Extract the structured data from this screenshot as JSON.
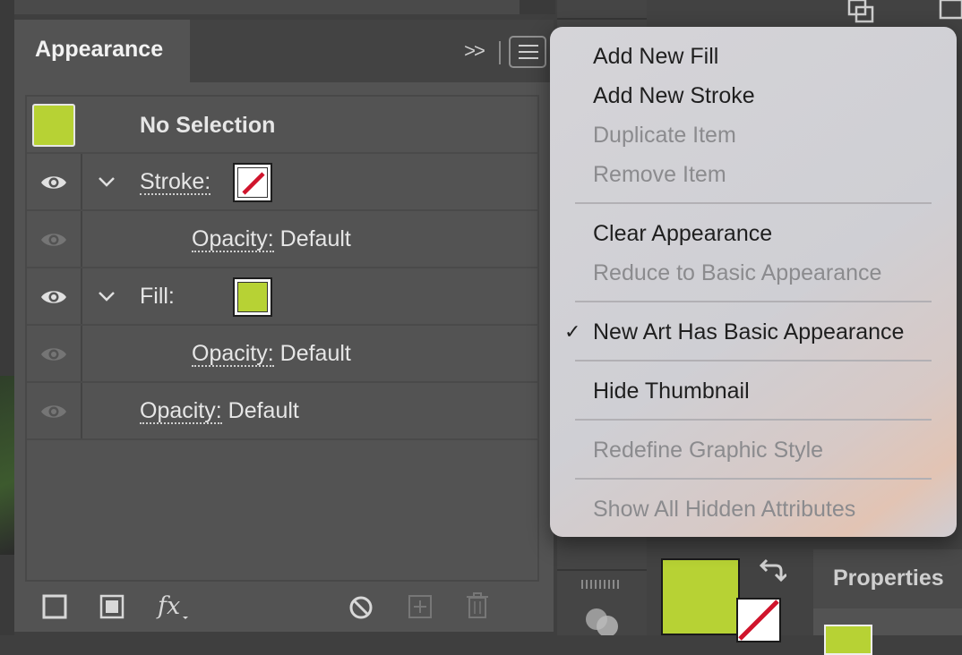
{
  "panel": {
    "tab_title": "Appearance",
    "collapse_glyph": ">>",
    "header_row": {
      "label": "No Selection",
      "thumb_color": "#b7d234"
    },
    "rows": [
      {
        "label": "Stroke:",
        "value": ""
      },
      {
        "label": "Opacity:",
        "value": "Default"
      },
      {
        "label": "Fill:",
        "value": ""
      },
      {
        "label": "Opacity:",
        "value": "Default"
      },
      {
        "label": "Opacity:",
        "value": "Default"
      }
    ],
    "fill_color": "#b7d234",
    "stroke_none_color": "#d0142c",
    "bottom_icons": [
      "add-new-stroke-icon",
      "add-new-fill-icon",
      "fx-icon",
      "clear-appearance-icon",
      "duplicate-item-icon",
      "delete-item-icon"
    ],
    "fx_label": "fx"
  },
  "menu": {
    "items": [
      {
        "label": "Add New Fill",
        "enabled": true
      },
      {
        "label": "Add New Stroke",
        "enabled": true
      },
      {
        "label": "Duplicate Item",
        "enabled": false
      },
      {
        "label": "Remove Item",
        "enabled": false
      },
      {
        "label": "Clear Appearance",
        "enabled": true
      },
      {
        "label": "Reduce to Basic Appearance",
        "enabled": false
      },
      {
        "label": "New Art Has Basic Appearance",
        "enabled": true,
        "checked": true
      },
      {
        "label": "Hide Thumbnail",
        "enabled": true
      },
      {
        "label": "Redefine Graphic Style",
        "enabled": false
      },
      {
        "label": "Show All Hidden Attributes",
        "enabled": false
      }
    ],
    "check_glyph": "✓"
  },
  "properties": {
    "tab_title": "Properties"
  },
  "colors": {
    "accent_fill": "#b7d234",
    "menu_bg": "#d2d1d6",
    "panel_bg": "#535353"
  }
}
